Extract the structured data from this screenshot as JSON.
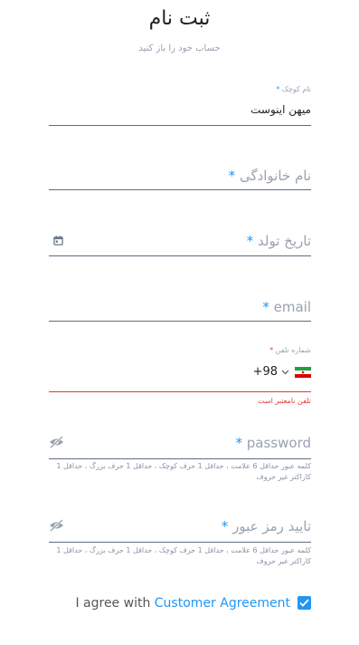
{
  "header": {
    "title": "ثبت نام",
    "subtitle": "حساب خود را باز کنید"
  },
  "form": {
    "first_name": {
      "label": "نام کوچک",
      "required_mark": "*",
      "value": "میهن اینوست"
    },
    "last_name": {
      "placeholder": "نام خانوادگی",
      "required_mark": "*"
    },
    "birth_date": {
      "placeholder": "تاریخ تولد",
      "required_mark": "*",
      "icon": "calendar-icon"
    },
    "email": {
      "placeholder": "email",
      "required_mark": "*"
    },
    "phone": {
      "label": "شماره تلفن",
      "required_mark": "*",
      "country_code": "+98",
      "flag": "iran-flag-icon",
      "error": "تلفن نامعتبر است"
    },
    "password": {
      "placeholder": "password",
      "required_mark": "*",
      "icon": "eye-off-icon",
      "hint": "کلمه عبور حداقل 6 علامت ، حداقل 1 حرف کوچک ، حداقل 1 حرف بزرگ ، حداقل 1 کاراکتر غیر حروف"
    },
    "confirm_password": {
      "placeholder": "تایید رمز عبور",
      "required_mark": "*",
      "icon": "eye-off-icon",
      "hint": "کلمه عبور حداقل 6 علامت ، حداقل 1 حرف کوچک ، حداقل 1 حرف بزرگ ، حداقل 1 کاراکتر غیر حروف"
    },
    "agreement": {
      "text": "I agree with",
      "link": "Customer Agreement",
      "checked": true
    }
  },
  "colors": {
    "accent": "#2196f3",
    "error": "#e53935",
    "placeholder": "#9aa1b0",
    "underline": "#5f6e7f"
  }
}
